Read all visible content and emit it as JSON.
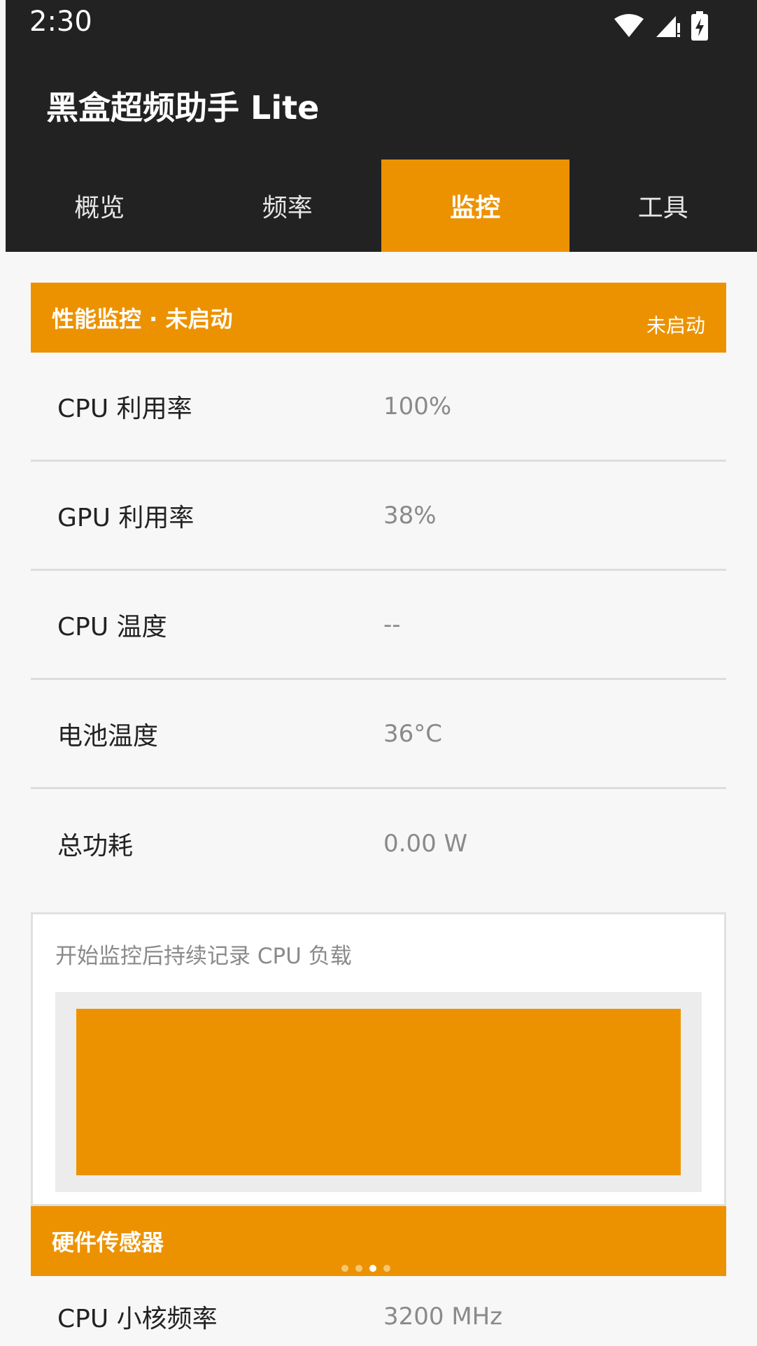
{
  "status_bar": {
    "time": "2:30",
    "icons": [
      "wifi-icon",
      "cellular-signal-icon",
      "battery-charging-icon"
    ]
  },
  "app": {
    "title": "黑盒超频助手 Lite"
  },
  "tabs": [
    {
      "label": "概览",
      "active": false
    },
    {
      "label": "频率",
      "active": false
    },
    {
      "label": "监控",
      "active": true
    },
    {
      "label": "工具",
      "active": false
    }
  ],
  "monitor": {
    "header_title": "性能监控 · 未启动",
    "header_status": "未启动",
    "rows": [
      {
        "label": "CPU 利用率",
        "value": "100%"
      },
      {
        "label": "GPU 利用率",
        "value": "38%"
      },
      {
        "label": "CPU 温度",
        "value": "--"
      },
      {
        "label": "电池温度",
        "value": "36°C"
      },
      {
        "label": "总功耗",
        "value": "0.00 W"
      }
    ],
    "chart_caption": "开始监控后持续记录 CPU 负载"
  },
  "sensors": {
    "header_title": "硬件传感器",
    "rows": [
      {
        "label": "CPU 小核频率",
        "value": "3200 MHz"
      }
    ]
  },
  "pager": {
    "count": 4,
    "active_index": 2
  },
  "colors": {
    "accent": "#ec9200",
    "header_bg": "#222222",
    "background": "#f7f7f7"
  },
  "chart_data": {
    "type": "area",
    "title": "",
    "x": [],
    "values": [],
    "ylim": [
      0,
      100
    ]
  }
}
